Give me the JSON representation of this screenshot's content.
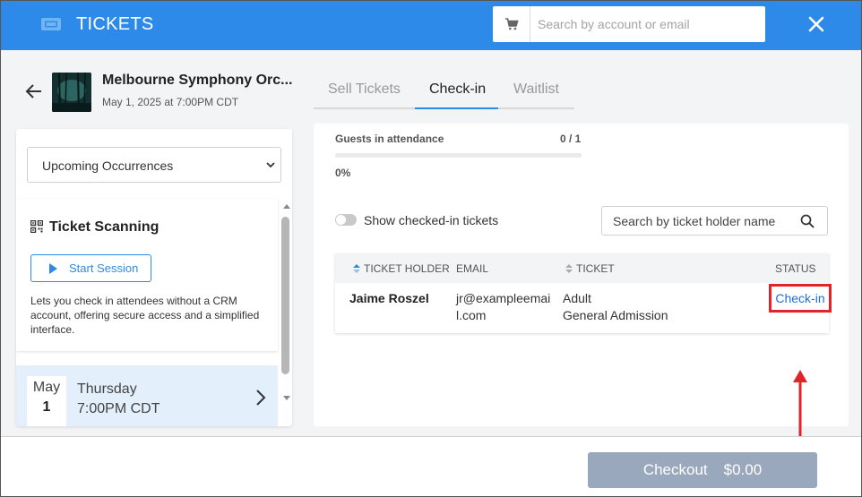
{
  "header": {
    "title": "TICKETS",
    "logo_icon": "ticket-icon",
    "cart_icon": "cart-icon",
    "search_placeholder": "Search by account or email",
    "close_icon": "close-icon",
    "brand_color": "#2d8ae8"
  },
  "event": {
    "title": "Melbourne Symphony Orc...",
    "date": "May 1, 2025 at 7:00PM CDT"
  },
  "left_panel": {
    "occurrence_select": "Upcoming Occurrences",
    "scanning": {
      "title": "Ticket Scanning",
      "button": "Start Session",
      "description": "Lets you check in attendees without a CRM account, offering secure access and a simplified interface."
    },
    "occurrence": {
      "month": "May",
      "day": "1",
      "weekday": "Thursday",
      "time": "7:00PM CDT"
    }
  },
  "tabs": [
    {
      "label": "Sell Tickets",
      "active": false
    },
    {
      "label": "Check-in",
      "active": true
    },
    {
      "label": "Waitlist",
      "active": false
    }
  ],
  "attendance": {
    "label": "Guests in attendance",
    "count": "0 / 1",
    "percent_label": "0%",
    "fraction": 0
  },
  "toggle_label": "Show checked-in tickets",
  "ticket_search_placeholder": "Search by ticket holder name",
  "table": {
    "headers": {
      "holder": "TICKET HOLDER",
      "email": "EMAIL",
      "ticket": "TICKET",
      "status": "STATUS"
    },
    "rows": [
      {
        "holder": "Jaime Roszel",
        "email": "jr@exampleemail.com",
        "ticket_type": "Adult",
        "ticket_admission": "General Admission",
        "action": "Check-in"
      }
    ]
  },
  "footer": {
    "checkout_label": "Checkout",
    "checkout_amount": "$0.00"
  }
}
